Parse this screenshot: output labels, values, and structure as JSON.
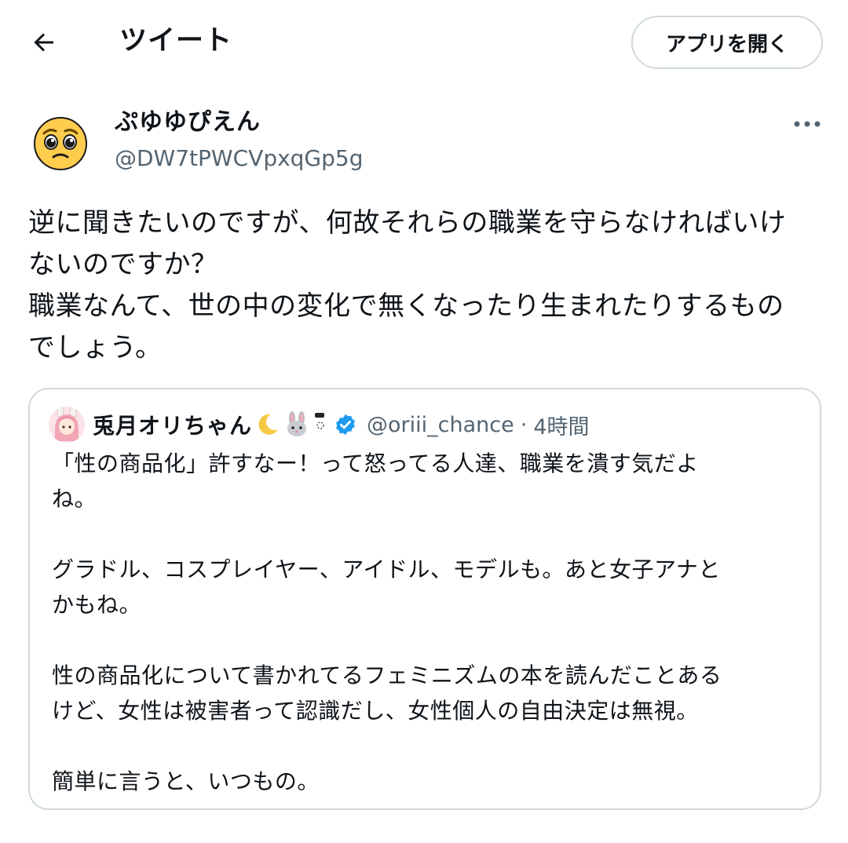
{
  "header": {
    "title": "ツイート",
    "open_app_label": "アプリを開く"
  },
  "author": {
    "display_name": "ぷゆゆぴえん",
    "handle": "@DW7tPWCVpxqGp5g",
    "avatar_icon": "pleading-face-emoji"
  },
  "tweet": {
    "text": "逆に聞きたいのですが、何故それらの職業を守らなければいけ\nないのですか？\n職業なんて、世の中の変化で無くなったり生まれたりするもの\nでしょう。"
  },
  "quote": {
    "display_name": "兎月オリちゃん",
    "name_emojis": [
      "crescent-moon-icon",
      "rabbit-face-icon",
      "sleep-mask-icon"
    ],
    "verified": true,
    "handle": "@oriii_chance",
    "separator": "·",
    "time": "4時間",
    "text": "「性の商品化」許すなー！って怒ってる人達、職業を潰す気だよ\nね。\n\nグラドル、コスプレイヤー、アイドル、モデルも。あと女子アナと\nかもね。\n\n性の商品化について書かれてるフェミニズムの本を読んだことある\nけど、女性は被害者って認識だし、女性個人の自由決定は無視。\n\n簡単に言うと、いつもの。"
  },
  "colors": {
    "text_primary": "#0f1419",
    "text_secondary": "#536471",
    "border": "#cfd9de",
    "verified_blue": "#1d9bf0",
    "avatar_yellow": "#ffcc4d"
  }
}
